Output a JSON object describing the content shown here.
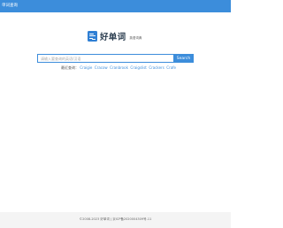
{
  "header": {
    "title": "单词查询"
  },
  "logo": {
    "icon": "dictionary-logo-icon",
    "name": "好单词",
    "subtitle": "英语词典",
    "color": "#2f7fd4"
  },
  "search": {
    "placeholder": "请输入要查询的英语/汉语",
    "value": "",
    "button_label": "Search"
  },
  "recent": {
    "label": "最近查询：",
    "words": [
      "Craigie",
      "Cracow",
      "Cranbrook",
      "Craigslist",
      "Crackers",
      "Crafe"
    ]
  },
  "footer": {
    "copyright": "©2008-2023 好单词 | 京ICP备2020004309号-11"
  },
  "colors": {
    "accent": "#3c8ddb",
    "footer_bg": "#f4f4f4"
  }
}
